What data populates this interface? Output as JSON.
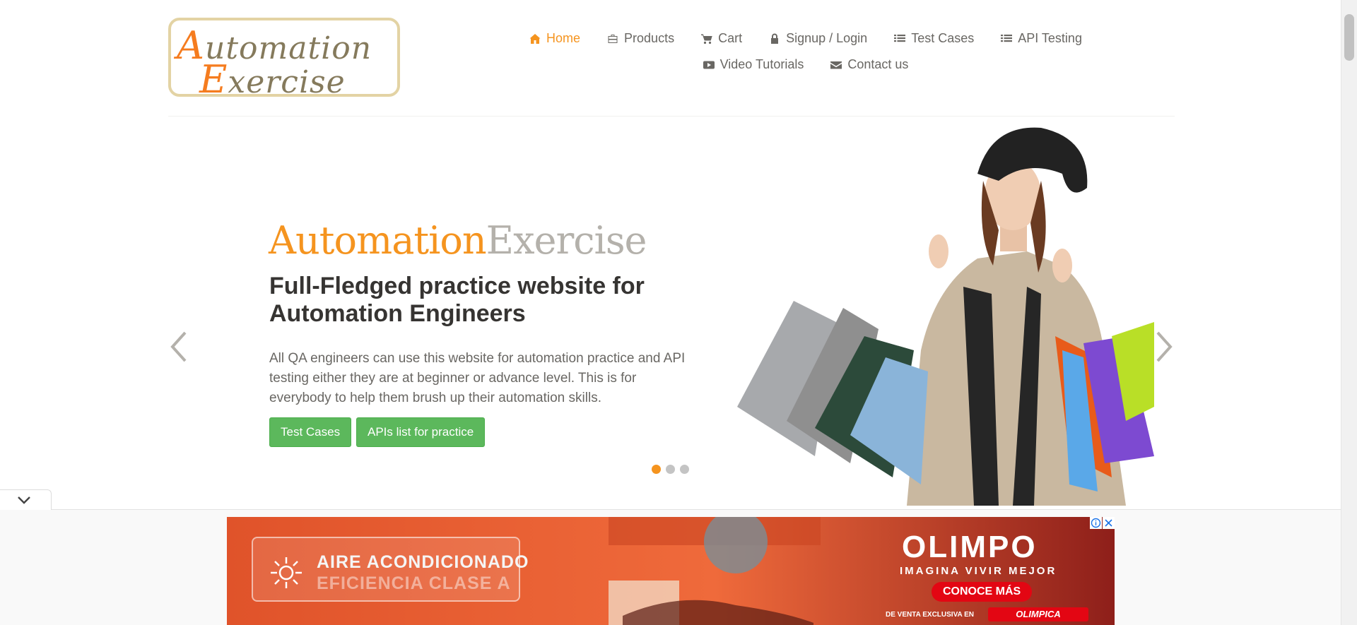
{
  "logo": {
    "line1_cap": "A",
    "line1_rest": "utomation",
    "line2_cap": "E",
    "line2_rest": "xercise"
  },
  "nav": {
    "items": [
      {
        "label": "Home",
        "icon": "home-icon",
        "active": true
      },
      {
        "label": "Products",
        "icon": "briefcase-icon"
      },
      {
        "label": "Cart",
        "icon": "cart-icon"
      },
      {
        "label": "Signup / Login",
        "icon": "lock-icon"
      },
      {
        "label": "Test Cases",
        "icon": "list-icon"
      },
      {
        "label": "API Testing",
        "icon": "list-icon"
      },
      {
        "label": "Video Tutorials",
        "icon": "youtube-play-icon"
      },
      {
        "label": "Contact us",
        "icon": "envelope-icon"
      }
    ]
  },
  "hero": {
    "brand_part1": "Automation",
    "brand_part2": "Exercise",
    "headline": "Full-Fledged practice website for Automation Engineers",
    "description": "All QA engineers can use this website for automation practice and API testing either they are at beginner or advance level. This is for everybody to help them brush up their automation skills.",
    "btn_test_cases": "Test Cases",
    "btn_apis": "APIs list for practice",
    "active_slide": 1,
    "slide_count": 3
  },
  "ad": {
    "line1": "AIRE ACONDICIONADO",
    "line2": "EFICIENCIA CLASE A",
    "brand": "OLIMPO",
    "tagline": "IMAGINA VIVIR MEJOR",
    "cta": "CONOCE MÁS",
    "exclusive": "DE VENTA EXCLUSIVA EN",
    "store": "OLIMPICA"
  },
  "colors": {
    "accent": "#f5941f",
    "button_green": "#5cb85c",
    "text": "#696763",
    "headline": "#363432"
  }
}
